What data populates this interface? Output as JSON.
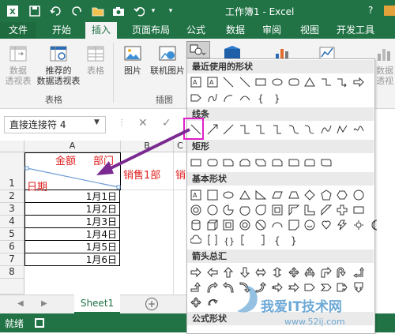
{
  "window": {
    "title": "工作簿1 - Excel"
  },
  "qat": {
    "icons": [
      "excel-logo-icon",
      "save-icon",
      "undo-icon",
      "redo-icon",
      "open-icon",
      "camera-icon",
      "undo-arrow-icon",
      "customize-icon"
    ]
  },
  "tabs": [
    "文件",
    "开始",
    "插入",
    "页面布局",
    "公式",
    "数据",
    "审阅",
    "视图",
    "开发工具"
  ],
  "active_tab": "插入",
  "ribbon": {
    "pivot_label_1": "数据",
    "pivot_label_2": "透视表",
    "recommended_label_1": "推荐的",
    "recommended_label_2": "数据透视表",
    "table_label": "表格",
    "group_tables": "表格",
    "pictures_label": "图片",
    "online_pictures_label": "联机图片",
    "group_illustrations": "插图",
    "right_label_1": "数据",
    "right_label_2": "透视"
  },
  "formula_bar": {
    "name_box": "直接连接符 4"
  },
  "grid": {
    "columns": [
      "A",
      "B",
      "C"
    ],
    "rows": [
      "1",
      "2",
      "3",
      "4",
      "5",
      "6",
      "7",
      "8",
      "9",
      "10",
      "11"
    ],
    "a1_amount": "金额",
    "a1_dept": "部门",
    "a1_date": "日期",
    "b1_text": "销售1部",
    "c1_text": "销",
    "dates": [
      "1月1日",
      "1月2日",
      "1月3日",
      "1月4日",
      "1月5日",
      "1月6日"
    ]
  },
  "sheet_tab": "Sheet1",
  "status": {
    "ready": "就绪"
  },
  "shapes_panel": {
    "recent": "最近使用的形状",
    "lines": "线条",
    "rectangles": "矩形",
    "basic": "基本形状",
    "arrows": "箭头总汇",
    "equation": "公式形状"
  },
  "watermark": {
    "text": "我爱IT技术网",
    "url": "www.52ij.com"
  },
  "colors": {
    "excel_green": "#217346",
    "red_text": "#e02020",
    "highlight": "#e020c8",
    "arrow": "#7a2a90"
  }
}
